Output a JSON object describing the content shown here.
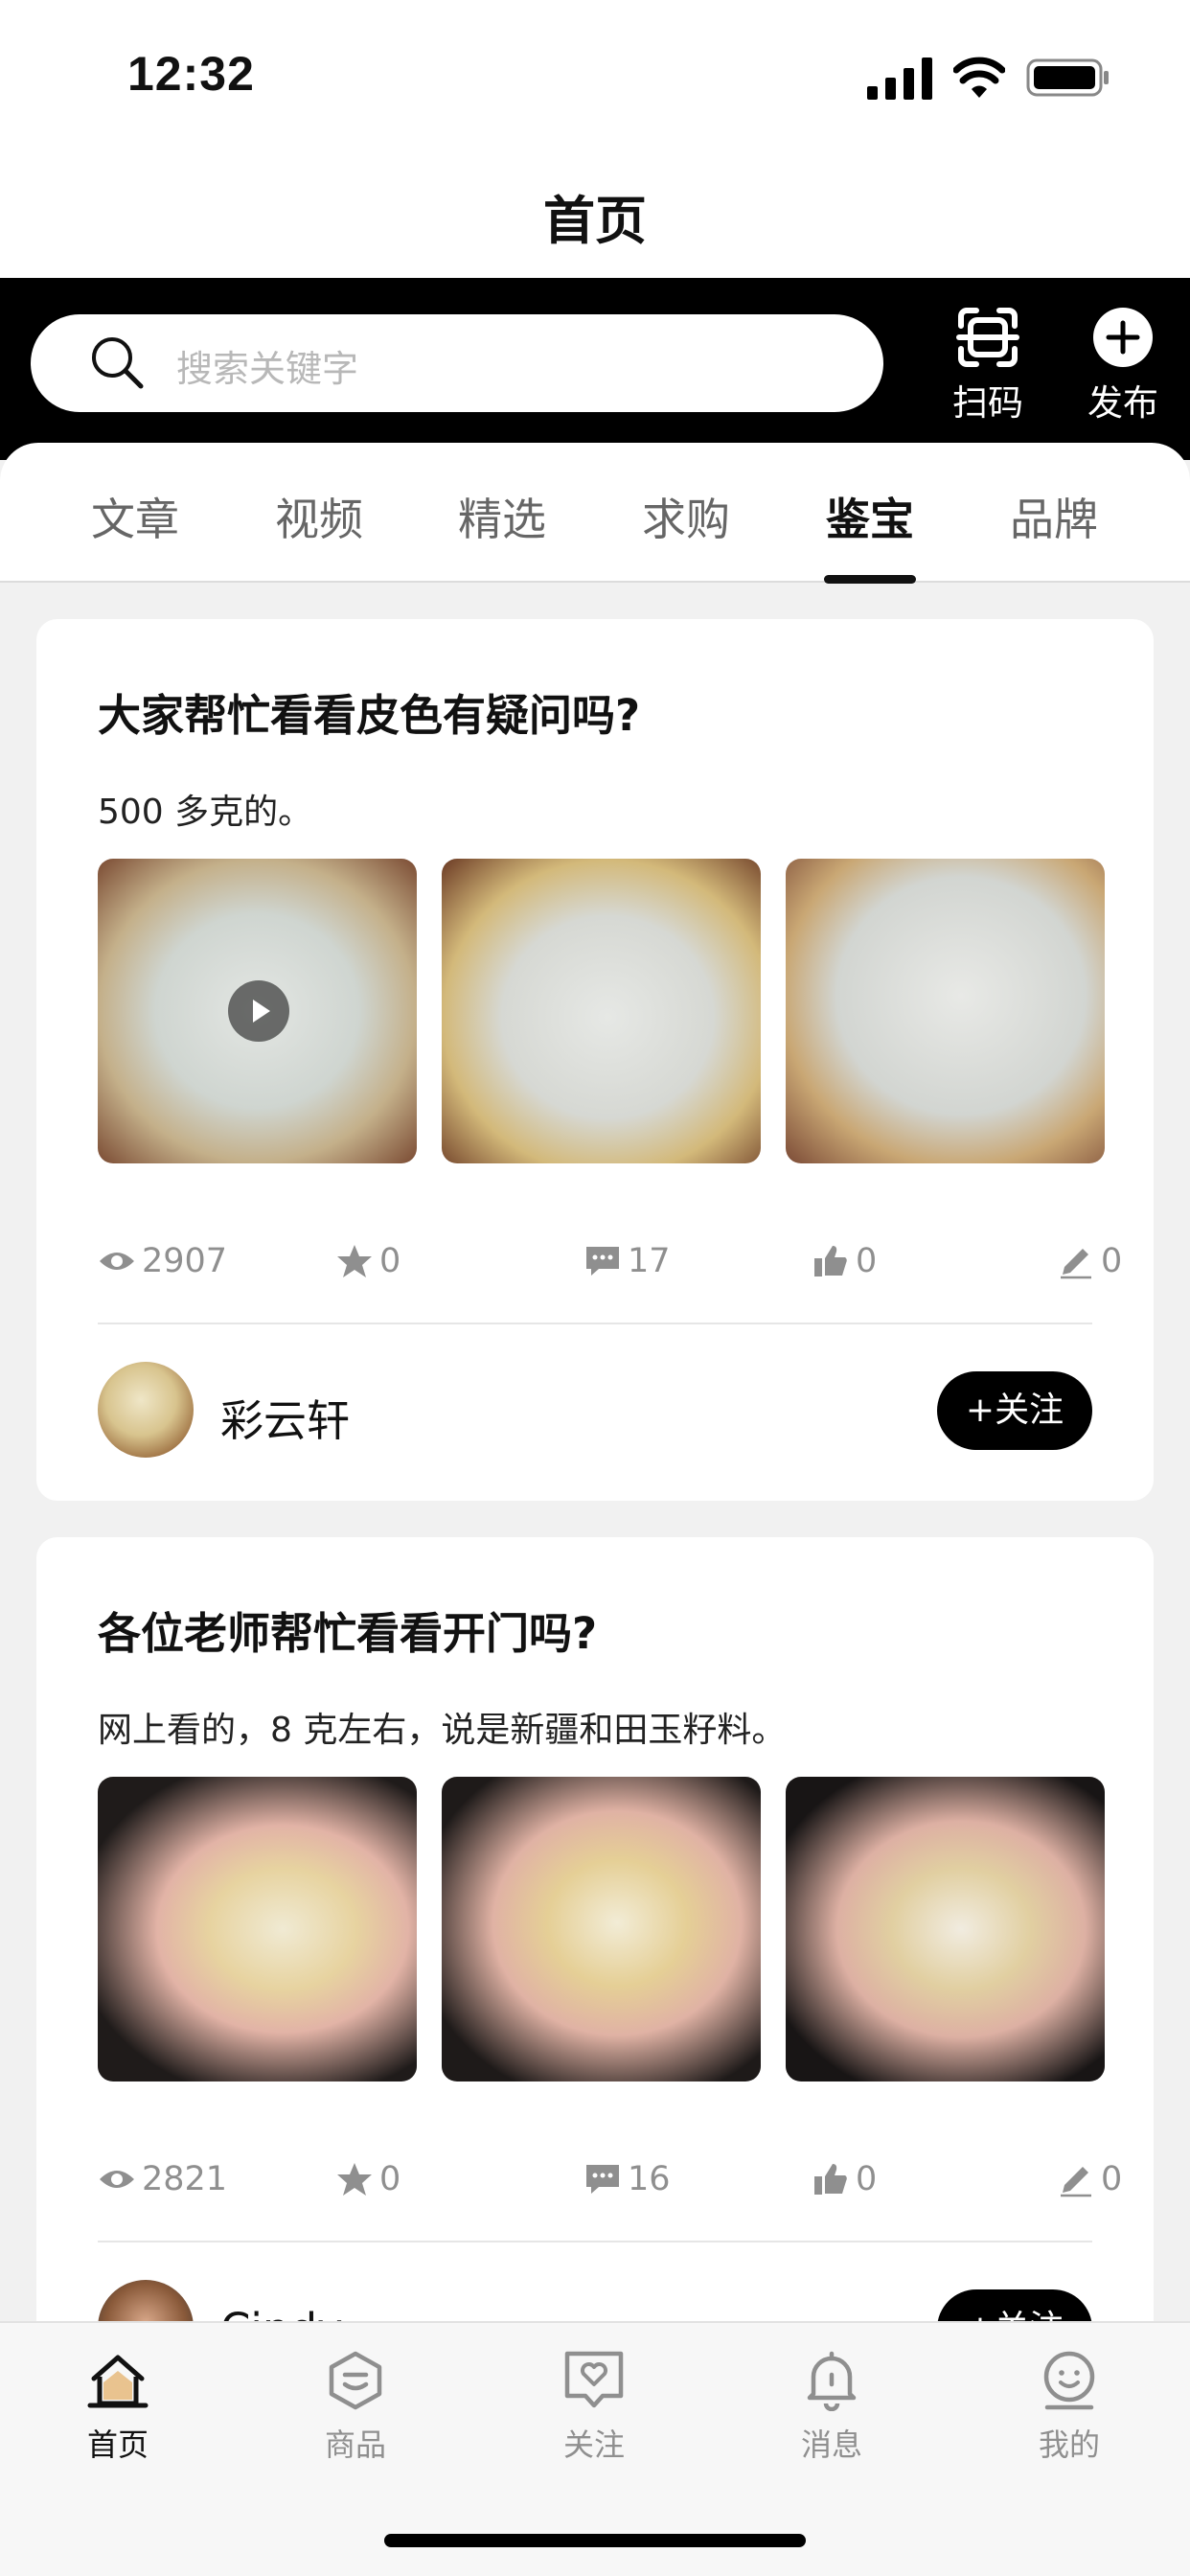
{
  "status_bar": {
    "time": "12:32"
  },
  "nav": {
    "title": "首页"
  },
  "search": {
    "placeholder": "搜索关键字"
  },
  "top_actions": {
    "scan_label": "扫码",
    "publish_label": "发布"
  },
  "tabs": [
    {
      "label": "文章",
      "active": false
    },
    {
      "label": "视频",
      "active": false
    },
    {
      "label": "精选",
      "active": false
    },
    {
      "label": "求购",
      "active": false
    },
    {
      "label": "鉴宝",
      "active": true
    },
    {
      "label": "品牌",
      "active": false
    }
  ],
  "posts": [
    {
      "title": "大家帮忙看看皮色有疑问吗?",
      "desc": "500 多克的。",
      "has_video": true,
      "stats": {
        "views": "2907",
        "favorites": "0",
        "comments": "17",
        "likes": "0",
        "edits": "0"
      },
      "author": "彩云轩",
      "follow_label": "+关注"
    },
    {
      "title": "各位老师帮忙看看开门吗?",
      "desc": "网上看的，8 克左右，说是新疆和田玉籽料。",
      "has_video": false,
      "stats": {
        "views": "2821",
        "favorites": "0",
        "comments": "16",
        "likes": "0",
        "edits": "0"
      },
      "author": "Cindy",
      "follow_label": "+关注"
    }
  ],
  "tabbar": [
    {
      "label": "首页",
      "icon": "home-icon",
      "active": true
    },
    {
      "label": "商品",
      "icon": "goods-icon",
      "active": false
    },
    {
      "label": "关注",
      "icon": "follow-icon",
      "active": false
    },
    {
      "label": "消息",
      "icon": "bell-icon",
      "active": false
    },
    {
      "label": "我的",
      "icon": "profile-icon",
      "active": false
    }
  ],
  "colors": {
    "accent": "#000000",
    "muted": "#8f8f8f",
    "background": "#f1f1f1"
  }
}
